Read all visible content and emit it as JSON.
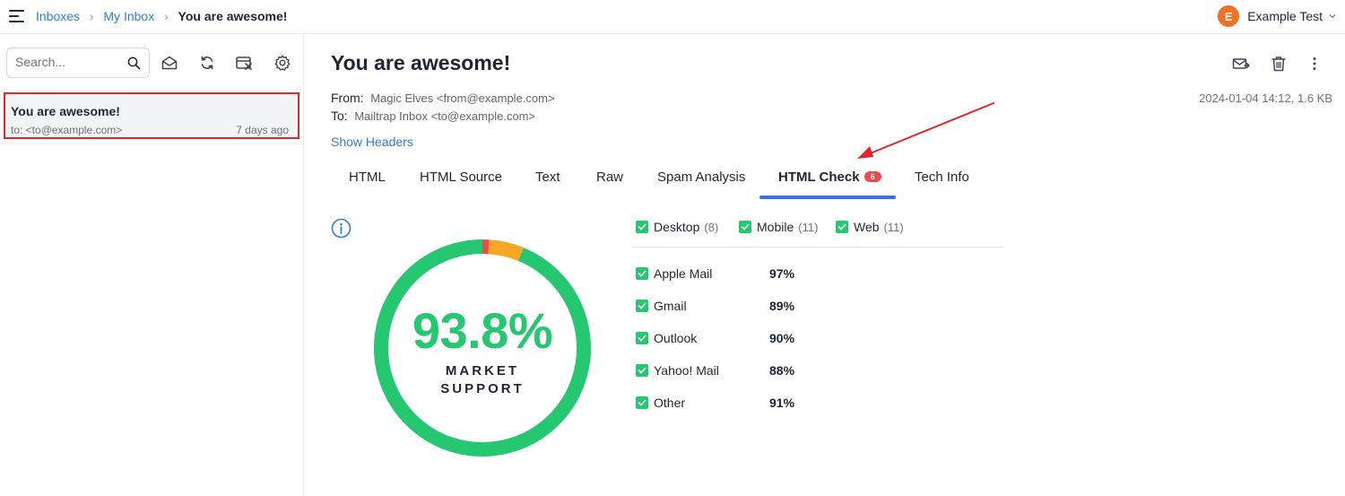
{
  "breadcrumb": {
    "items": [
      "Inboxes",
      "My Inbox"
    ],
    "current": "You are awesome!",
    "separator": "›"
  },
  "user": {
    "initial": "E",
    "name": "Example Test",
    "avatar_color": "#f07125"
  },
  "sidebar": {
    "search_placeholder": "Search...",
    "tools": [
      "envelope-open-icon",
      "refresh-icon",
      "clear-inbox-icon",
      "gear-icon"
    ],
    "messages": [
      {
        "subject": "You are awesome!",
        "to": "to: <to@example.com>",
        "time": "7 days ago"
      }
    ]
  },
  "message": {
    "subject": "You are awesome!",
    "from_label": "From:",
    "from_value": "Magic Elves <from@example.com>",
    "to_label": "To:",
    "to_value": "Mailtrap Inbox <to@example.com>",
    "meta": "2024-01-04 14:12, 1.6 KB",
    "show_headers": "Show Headers",
    "actions": [
      "forward-icon",
      "trash-icon",
      "more-vertical-icon"
    ]
  },
  "tabs": [
    {
      "label": "HTML"
    },
    {
      "label": "HTML Source"
    },
    {
      "label": "Text"
    },
    {
      "label": "Raw"
    },
    {
      "label": "Spam Analysis"
    },
    {
      "label": "HTML Check",
      "badge": "6",
      "active": true
    },
    {
      "label": "Tech Info"
    }
  ],
  "html_check": {
    "market_support_value": "93.8%",
    "market_support_label_1": "MARKET",
    "market_support_label_2": "SUPPORT",
    "donut_segments": [
      {
        "name": "supported",
        "fraction": 0.938,
        "color": "#26c771"
      },
      {
        "name": "partial",
        "fraction": 0.052,
        "color": "#f5a623"
      },
      {
        "name": "unsupported",
        "fraction": 0.01,
        "color": "#ef4a4a"
      }
    ],
    "filters": [
      {
        "label": "Desktop",
        "count": "(8)",
        "checked": true
      },
      {
        "label": "Mobile",
        "count": "(11)",
        "checked": true
      },
      {
        "label": "Web",
        "count": "(11)",
        "checked": true
      }
    ],
    "clients": [
      {
        "name": "Apple Mail",
        "support": "97%",
        "checked": true
      },
      {
        "name": "Gmail",
        "support": "89%",
        "checked": true
      },
      {
        "name": "Outlook",
        "support": "90%",
        "checked": true
      },
      {
        "name": "Yahoo! Mail",
        "support": "88%",
        "checked": true
      },
      {
        "name": "Other",
        "support": "91%",
        "checked": true
      }
    ]
  },
  "colors": {
    "accent_blue": "#2f7bd6",
    "tab_underline": "#3f6fe0",
    "success_green": "#26c771",
    "highlight_red": "#e3262a"
  }
}
